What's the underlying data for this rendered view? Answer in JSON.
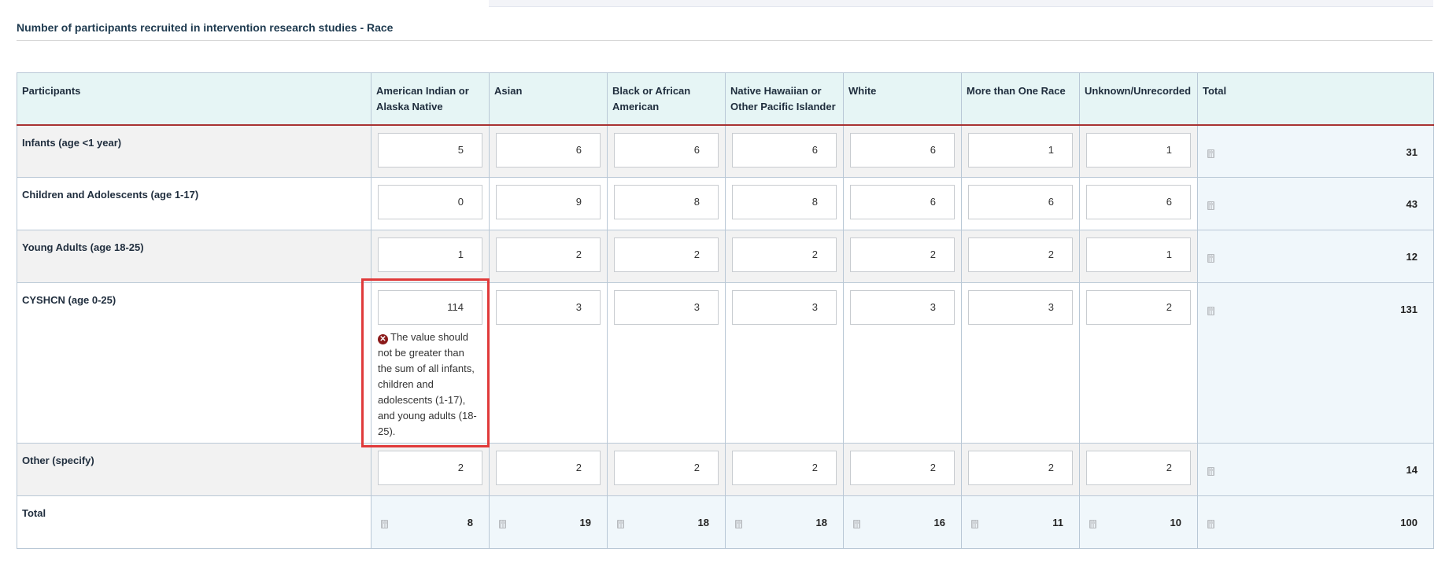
{
  "section_title": "Number of participants recruited in intervention research studies - Race",
  "columns": [
    "Participants",
    "American Indian or Alaska Native",
    "Asian",
    "Black or African American",
    "Native Hawaiian or Other Pacific Islander",
    "White",
    "More than One Race",
    "Unknown/Unrecorded",
    "Total"
  ],
  "rows": [
    {
      "label": "Infants (age <1 year)",
      "values": [
        "5",
        "6",
        "6",
        "6",
        "6",
        "1",
        "1"
      ],
      "total": "31"
    },
    {
      "label": "Children and Adolescents (age 1-17)",
      "values": [
        "0",
        "9",
        "8",
        "8",
        "6",
        "6",
        "6"
      ],
      "total": "43"
    },
    {
      "label": "Young Adults (age 18-25)",
      "values": [
        "1",
        "2",
        "2",
        "2",
        "2",
        "2",
        "1"
      ],
      "total": "12"
    },
    {
      "label": "CYSHCN (age 0-25)",
      "values": [
        "114",
        "3",
        "3",
        "3",
        "3",
        "3",
        "2"
      ],
      "total": "131",
      "error": "The value should not be greater than the sum of all infants, children and adolescents (1-17), and young adults (18-25)."
    },
    {
      "label": "Other (specify)",
      "values": [
        "2",
        "2",
        "2",
        "2",
        "2",
        "2",
        "2"
      ],
      "total": "14"
    }
  ],
  "totals_row": {
    "label": "Total",
    "values": [
      "8",
      "19",
      "18",
      "18",
      "16",
      "11",
      "10"
    ],
    "total": "100"
  },
  "icons": {
    "calculator": "calculator-icon",
    "error": "error-circle-icon"
  },
  "colors": {
    "header_bg": "#e6f5f5",
    "header_rule": "#a83232",
    "error_icon": "#8b1a1a",
    "highlight": "#e03a3a"
  }
}
